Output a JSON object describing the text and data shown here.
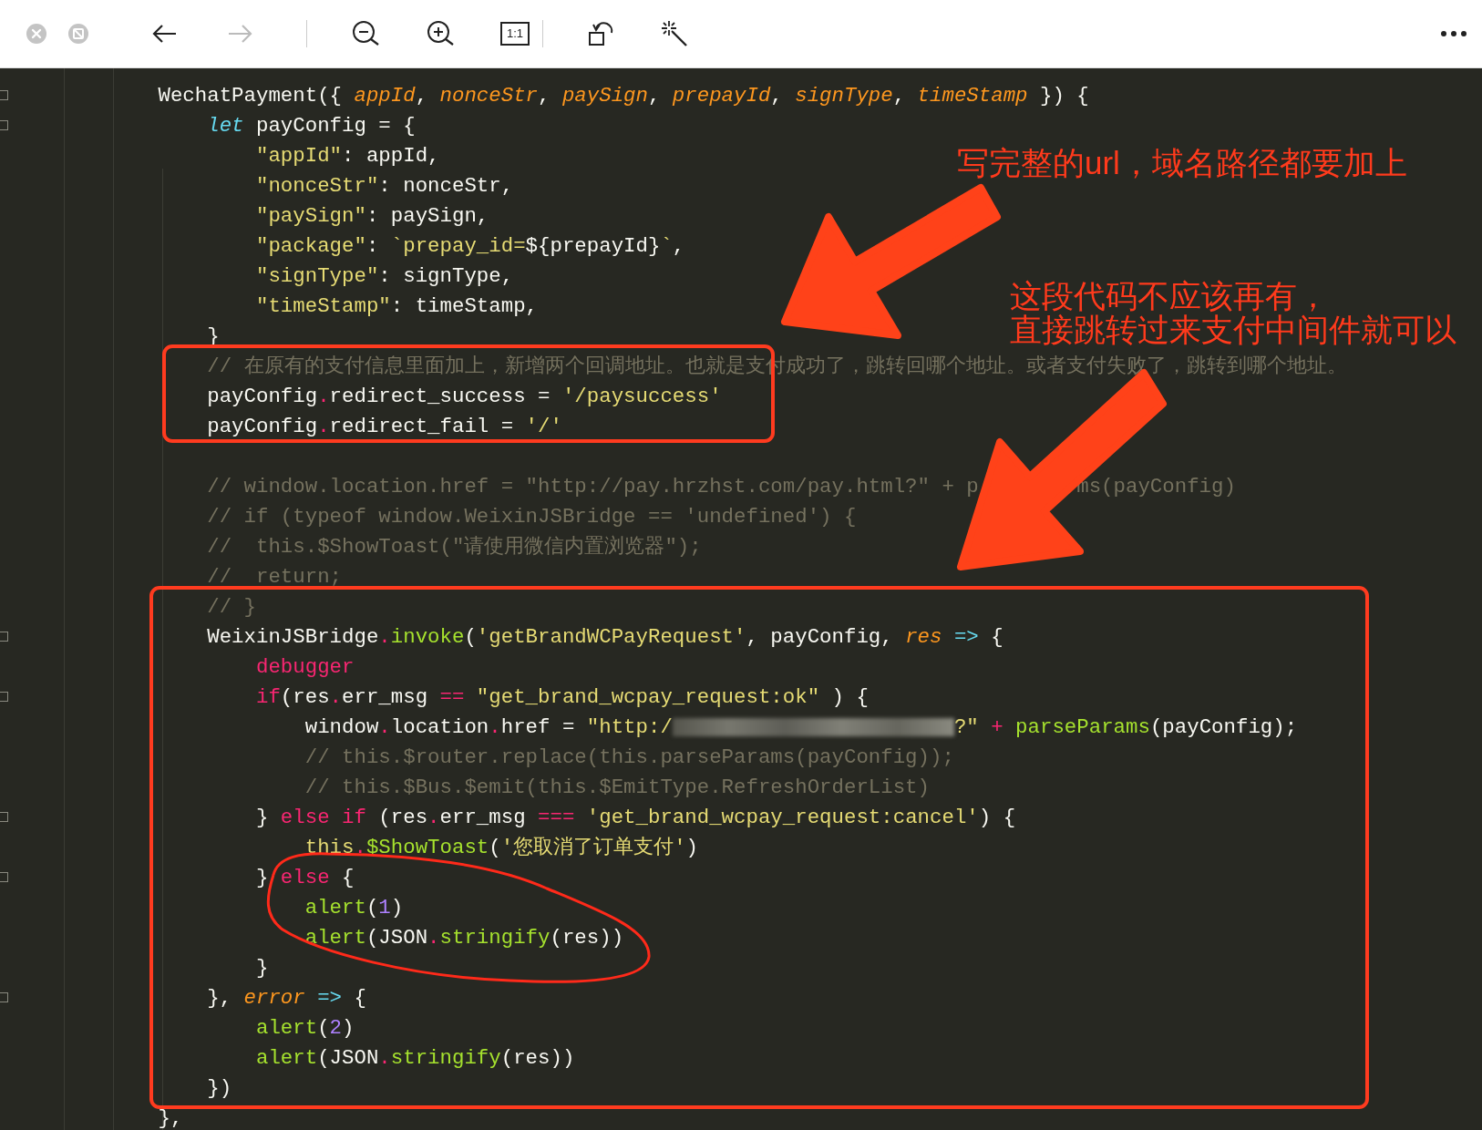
{
  "toolbar": {
    "items": [
      {
        "kind": "close",
        "disabled": false
      },
      {
        "kind": "stop",
        "disabled": false
      },
      {
        "kind": "back",
        "disabled": false
      },
      {
        "kind": "forward",
        "disabled": true
      },
      {
        "kind": "separator"
      },
      {
        "kind": "zoom-out",
        "disabled": false
      },
      {
        "kind": "zoom-in",
        "disabled": false
      },
      {
        "kind": "actual-size",
        "label": "1:1",
        "disabled": false
      },
      {
        "kind": "separator"
      },
      {
        "kind": "rotate",
        "disabled": false
      },
      {
        "kind": "magic",
        "disabled": false
      },
      {
        "kind": "more",
        "disabled": false
      }
    ]
  },
  "code": {
    "lines": [
      {
        "kind": "code",
        "fold": true,
        "tokens": [
          {
            "kind": "plain",
            "text": "        WechatPayment({ "
          },
          {
            "kind": "param",
            "text": "appId"
          },
          {
            "kind": "plain",
            "text": ", "
          },
          {
            "kind": "param",
            "text": "nonceStr"
          },
          {
            "kind": "plain",
            "text": ", "
          },
          {
            "kind": "param",
            "text": "paySign"
          },
          {
            "kind": "plain",
            "text": ", "
          },
          {
            "kind": "param",
            "text": "prepayId"
          },
          {
            "kind": "plain",
            "text": ", "
          },
          {
            "kind": "param",
            "text": "signType"
          },
          {
            "kind": "plain",
            "text": ", "
          },
          {
            "kind": "param",
            "text": "timeStamp"
          },
          {
            "kind": "plain",
            "text": " }) {"
          }
        ]
      },
      {
        "kind": "code",
        "fold": true,
        "tokens": [
          {
            "kind": "storage",
            "text": "            let"
          },
          {
            "kind": "plain",
            "text": " payConfig = {"
          }
        ]
      },
      {
        "kind": "code",
        "fold": false,
        "tokens": [
          {
            "kind": "string",
            "text": "                \"appId\""
          },
          {
            "kind": "plain",
            "text": ": appId,"
          }
        ]
      },
      {
        "kind": "code",
        "fold": false,
        "tokens": [
          {
            "kind": "string",
            "text": "                \"nonceStr\""
          },
          {
            "kind": "plain",
            "text": ": nonceStr,"
          }
        ]
      },
      {
        "kind": "code",
        "fold": false,
        "tokens": [
          {
            "kind": "string",
            "text": "                \"paySign\""
          },
          {
            "kind": "plain",
            "text": ": paySign,"
          }
        ]
      },
      {
        "kind": "code",
        "fold": false,
        "tokens": [
          {
            "kind": "string",
            "text": "                \"package\""
          },
          {
            "kind": "plain",
            "text": ": "
          },
          {
            "kind": "string",
            "text": "`prepay_id="
          },
          {
            "kind": "plain",
            "text": "${prepayId}"
          },
          {
            "kind": "string",
            "text": "`"
          },
          {
            "kind": "plain",
            "text": ","
          }
        ]
      },
      {
        "kind": "code",
        "fold": false,
        "tokens": [
          {
            "kind": "string",
            "text": "                \"signType\""
          },
          {
            "kind": "plain",
            "text": ": signType,"
          }
        ]
      },
      {
        "kind": "code",
        "fold": false,
        "tokens": [
          {
            "kind": "string",
            "text": "                \"timeStamp\""
          },
          {
            "kind": "plain",
            "text": ": timeStamp,"
          }
        ]
      },
      {
        "kind": "code",
        "fold": false,
        "tokens": [
          {
            "kind": "plain",
            "text": "            }"
          }
        ]
      },
      {
        "kind": "code",
        "fold": false,
        "tokens": [
          {
            "kind": "comment",
            "text": "            // 在原有的支付信息里面加上，新增两个回调地址。也就是支付成功了，跳转回哪个地址。或者支付失败了，跳转到哪个地址。"
          }
        ]
      },
      {
        "kind": "code",
        "fold": false,
        "tokens": [
          {
            "kind": "plain",
            "text": "            payConfig"
          },
          {
            "kind": "op",
            "text": "."
          },
          {
            "kind": "plain",
            "text": "redirect_success = "
          },
          {
            "kind": "string",
            "text": "'/paysuccess'"
          }
        ]
      },
      {
        "kind": "code",
        "fold": false,
        "tokens": [
          {
            "kind": "plain",
            "text": "            payConfig"
          },
          {
            "kind": "op",
            "text": "."
          },
          {
            "kind": "plain",
            "text": "redirect_fail = "
          },
          {
            "kind": "string",
            "text": "'/'"
          }
        ]
      },
      {
        "kind": "blank",
        "fold": false
      },
      {
        "kind": "code",
        "fold": false,
        "tokens": [
          {
            "kind": "comment",
            "text": "            // window.location.href = \"http://pay.hrzhst.com/pay.html?\" + p"
          },
          {
            "kind": "covered"
          },
          {
            "kind": "comment",
            "text": "ms(payConfig)"
          }
        ]
      },
      {
        "kind": "code",
        "fold": false,
        "tokens": [
          {
            "kind": "comment",
            "text": "            // if (typeof window.WeixinJSBridge == 'undefined') {"
          }
        ]
      },
      {
        "kind": "code",
        "fold": false,
        "tokens": [
          {
            "kind": "comment",
            "text": "            //  this.$ShowToast(\"请使用微信内置浏览器\");"
          }
        ]
      },
      {
        "kind": "code",
        "fold": false,
        "tokens": [
          {
            "kind": "comment",
            "text": "            //  return;"
          }
        ]
      },
      {
        "kind": "code",
        "fold": false,
        "tokens": [
          {
            "kind": "comment",
            "text": "            // }"
          }
        ]
      },
      {
        "kind": "code",
        "fold": true,
        "tokens": [
          {
            "kind": "plain",
            "text": "            WeixinJSBridge"
          },
          {
            "kind": "op",
            "text": "."
          },
          {
            "kind": "function",
            "text": "invoke"
          },
          {
            "kind": "plain",
            "text": "("
          },
          {
            "kind": "string",
            "text": "'getBrandWCPayRequest'"
          },
          {
            "kind": "plain",
            "text": ", payConfig, "
          },
          {
            "kind": "param",
            "text": "res"
          },
          {
            "kind": "arrow",
            "text": " =>"
          },
          {
            "kind": "plain",
            "text": " {"
          }
        ]
      },
      {
        "kind": "code",
        "fold": false,
        "tokens": [
          {
            "kind": "keyword",
            "text": "                debugger"
          }
        ]
      },
      {
        "kind": "code",
        "fold": true,
        "tokens": [
          {
            "kind": "keyword",
            "text": "                if"
          },
          {
            "kind": "plain",
            "text": "(res"
          },
          {
            "kind": "op",
            "text": "."
          },
          {
            "kind": "plain",
            "text": "err_msg "
          },
          {
            "kind": "keyword",
            "text": "== "
          },
          {
            "kind": "string",
            "text": "\"get_brand_wcpay_request:ok\""
          },
          {
            "kind": "plain",
            "text": " ) {"
          }
        ]
      },
      {
        "kind": "code",
        "fold": false,
        "tokens": [
          {
            "kind": "plain",
            "text": "                    window"
          },
          {
            "kind": "op",
            "text": "."
          },
          {
            "kind": "plain",
            "text": "location"
          },
          {
            "kind": "op",
            "text": "."
          },
          {
            "kind": "plain",
            "text": "href = "
          },
          {
            "kind": "string",
            "text": "\"http:/"
          },
          {
            "kind": "redacted"
          },
          {
            "kind": "string",
            "text": "?\""
          },
          {
            "kind": "keyword",
            "text": " + "
          },
          {
            "kind": "function",
            "text": "parseParams"
          },
          {
            "kind": "plain",
            "text": "(payConfig);"
          }
        ]
      },
      {
        "kind": "code",
        "fold": false,
        "tokens": [
          {
            "kind": "comment",
            "text": "                    // this.$router.replace(this.parseParams(payConfig));"
          }
        ]
      },
      {
        "kind": "code",
        "fold": false,
        "tokens": [
          {
            "kind": "comment",
            "text": "                    // this.$Bus.$emit(this.$EmitType.RefreshOrderList)"
          }
        ]
      },
      {
        "kind": "code",
        "fold": true,
        "tokens": [
          {
            "kind": "plain",
            "text": "                } "
          },
          {
            "kind": "keyword",
            "text": "else if"
          },
          {
            "kind": "plain",
            "text": " (res"
          },
          {
            "kind": "op",
            "text": "."
          },
          {
            "kind": "plain",
            "text": "err_msg "
          },
          {
            "kind": "keyword",
            "text": "=== "
          },
          {
            "kind": "string",
            "text": "'get_brand_wcpay_request:cancel'"
          },
          {
            "kind": "plain",
            "text": ") {"
          }
        ]
      },
      {
        "kind": "code",
        "fold": false,
        "tokens": [
          {
            "kind": "this",
            "text": "                    this"
          },
          {
            "kind": "op",
            "text": "."
          },
          {
            "kind": "function",
            "text": "$ShowToast"
          },
          {
            "kind": "plain",
            "text": "("
          },
          {
            "kind": "string",
            "text": "'您取消了订单支付'"
          },
          {
            "kind": "plain",
            "text": ")"
          }
        ]
      },
      {
        "kind": "code",
        "fold": true,
        "tokens": [
          {
            "kind": "plain",
            "text": "                } "
          },
          {
            "kind": "keyword",
            "text": "else"
          },
          {
            "kind": "plain",
            "text": " {"
          }
        ]
      },
      {
        "kind": "code",
        "fold": false,
        "tokens": [
          {
            "kind": "function",
            "text": "                    alert"
          },
          {
            "kind": "plain",
            "text": "("
          },
          {
            "kind": "number",
            "text": "1"
          },
          {
            "kind": "plain",
            "text": ")"
          }
        ]
      },
      {
        "kind": "code",
        "fold": false,
        "tokens": [
          {
            "kind": "function",
            "text": "                    alert"
          },
          {
            "kind": "plain",
            "text": "(JSON"
          },
          {
            "kind": "op",
            "text": "."
          },
          {
            "kind": "function",
            "text": "stringify"
          },
          {
            "kind": "plain",
            "text": "(res))"
          }
        ]
      },
      {
        "kind": "code",
        "fold": false,
        "tokens": [
          {
            "kind": "plain",
            "text": "                }"
          }
        ]
      },
      {
        "kind": "code",
        "fold": true,
        "tokens": [
          {
            "kind": "plain",
            "text": "            }, "
          },
          {
            "kind": "param",
            "text": "error"
          },
          {
            "kind": "arrow",
            "text": " =>"
          },
          {
            "kind": "plain",
            "text": " {"
          }
        ]
      },
      {
        "kind": "code",
        "fold": false,
        "tokens": [
          {
            "kind": "function",
            "text": "                alert"
          },
          {
            "kind": "plain",
            "text": "("
          },
          {
            "kind": "number",
            "text": "2"
          },
          {
            "kind": "plain",
            "text": ")"
          }
        ]
      },
      {
        "kind": "code",
        "fold": false,
        "tokens": [
          {
            "kind": "function",
            "text": "                alert"
          },
          {
            "kind": "plain",
            "text": "(JSON"
          },
          {
            "kind": "op",
            "text": "."
          },
          {
            "kind": "function",
            "text": "stringify"
          },
          {
            "kind": "plain",
            "text": "(res))"
          }
        ]
      },
      {
        "kind": "code",
        "fold": false,
        "tokens": [
          {
            "kind": "plain",
            "text": "            })"
          }
        ]
      },
      {
        "kind": "code",
        "fold": false,
        "tokens": [
          {
            "kind": "plain",
            "text": "        },"
          }
        ]
      }
    ]
  },
  "annotations": {
    "notes": [
      {
        "lines": [
          "写完整的url，域名路径都要加上"
        ]
      },
      {
        "lines": [
          "这段代码不应该再有，",
          "直接跳转过来支付中间件就可以"
        ]
      }
    ]
  }
}
